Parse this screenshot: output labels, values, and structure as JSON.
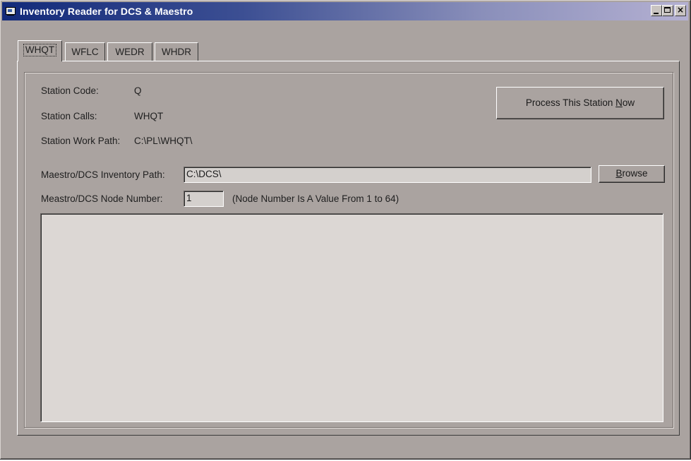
{
  "window": {
    "title": "Inventory Reader for DCS & Maestro",
    "controls": {
      "minimize_icon": "minimize-icon",
      "maximize_icon": "maximize-icon",
      "close_glyph": "×"
    }
  },
  "tabs": [
    {
      "label": "WHQT",
      "active": true
    },
    {
      "label": "WFLC",
      "active": false
    },
    {
      "label": "WEDR",
      "active": false
    },
    {
      "label": "WHDR",
      "active": false
    }
  ],
  "station": {
    "code_label": "Station Code:",
    "code_value": "Q",
    "calls_label": "Station Calls:",
    "calls_value": "WHQT",
    "work_path_label": "Station Work Path:",
    "work_path_value": "C:\\PL\\WHQT\\"
  },
  "process_button": {
    "label_before": "Process This Station ",
    "label_mnemonic": "N",
    "label_after": "ow"
  },
  "inventory": {
    "path_label": "Maestro/DCS Inventory Path:",
    "path_value": "C:\\DCS\\",
    "browse_mnemonic": "B",
    "browse_rest": "rowse",
    "node_label": "Meastro/DCS Node Number:",
    "node_value": "1",
    "node_hint": "(Node Number Is A Value From 1 to 64)"
  },
  "log": {
    "content": ""
  },
  "colors": {
    "face": "#aaa3a0",
    "title_start": "#132a7a",
    "title_end": "#b4b0d2",
    "field_bg": "#d4d0cd"
  }
}
